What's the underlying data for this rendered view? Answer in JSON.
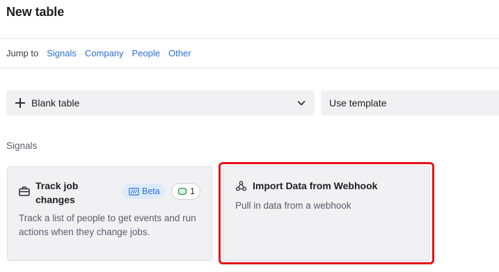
{
  "header": {
    "title": "New table"
  },
  "jump": {
    "label": "Jump to",
    "links": [
      "Signals",
      "Company",
      "People",
      "Other"
    ]
  },
  "actions": {
    "blank_table": "Blank table",
    "use_template": "Use template"
  },
  "signals": {
    "section_label": "Signals",
    "cards": [
      {
        "title": "Track job changes",
        "icon": "briefcase-icon",
        "badge_beta": "Beta",
        "badge_count": "1",
        "description": "Track a list of people to get events and run actions when they change jobs."
      },
      {
        "title": "Import Data from Webhook",
        "icon": "webhook-icon",
        "description": "Pull in data from a webhook",
        "highlighted": true
      }
    ]
  },
  "colors": {
    "link": "#2b6fd6",
    "highlight": "#e8101a",
    "card_bg": "#f1f1f3",
    "beta_bg": "#dcebfb"
  }
}
